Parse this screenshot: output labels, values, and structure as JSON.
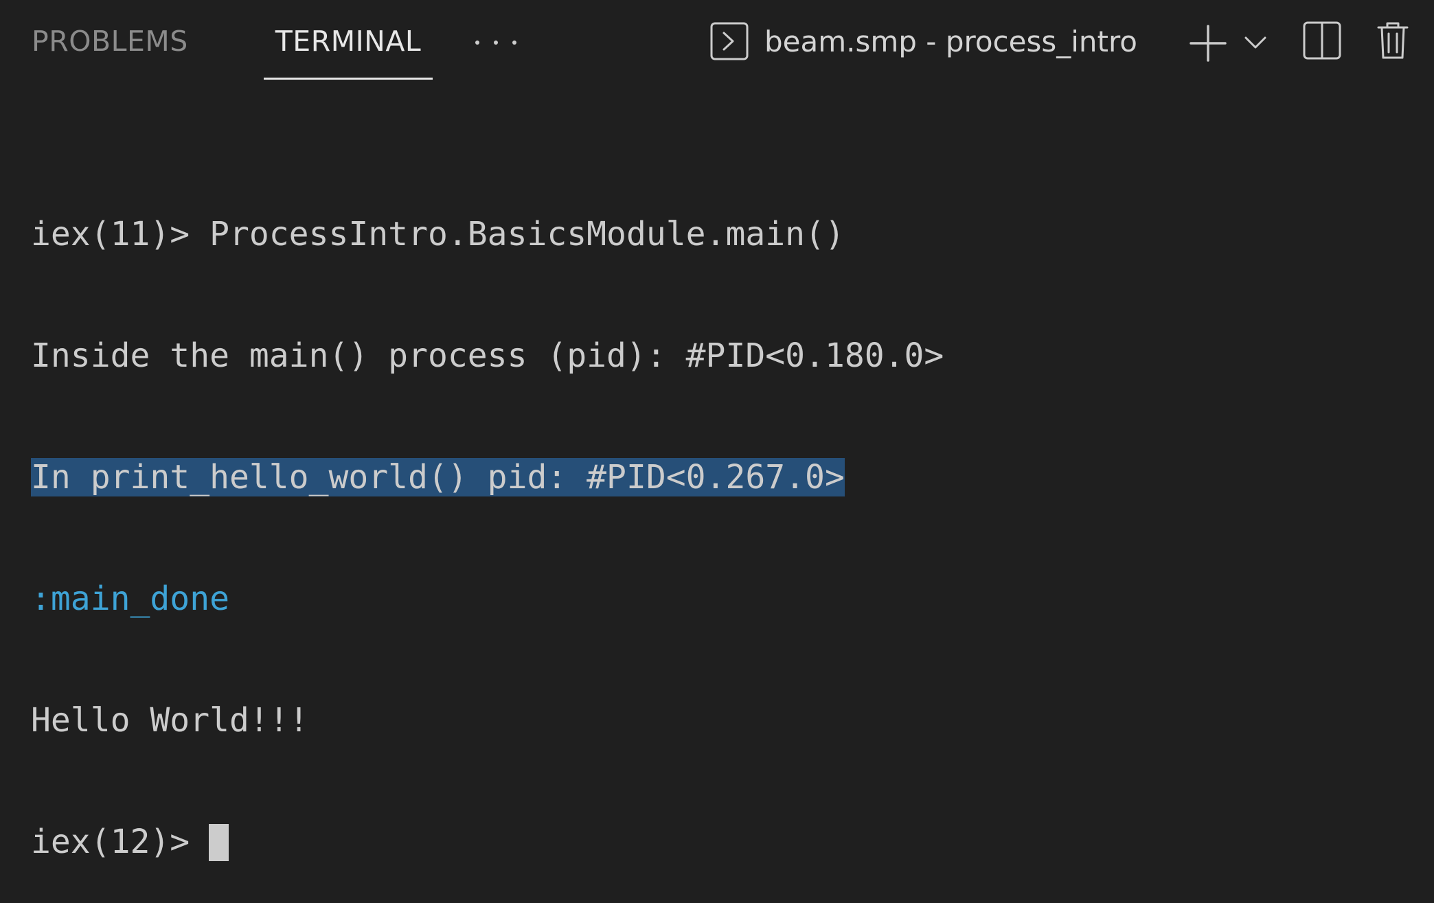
{
  "panel": {
    "tabs": [
      {
        "label": "PROBLEMS",
        "active": false
      },
      {
        "label": "TERMINAL",
        "active": true
      }
    ],
    "more_icon": "ellipsis-icon",
    "terminal_title": "beam.smp - process_intro",
    "icons": {
      "terminal": "terminal-icon",
      "new_terminal": "plus-icon",
      "dropdown": "chevron-down-icon",
      "split": "split-editor-icon",
      "kill": "trash-icon"
    }
  },
  "terminal": {
    "lines": [
      "iex(11)> ProcessIntro.BasicsModule.main()",
      "Inside the main() process (pid): #PID<0.180.0>",
      "In print_hello_world() pid: #PID<0.267.0>",
      ":main_done",
      "Hello World!!!"
    ],
    "prompt": "iex(12)>"
  },
  "colors": {
    "background": "#1f1f1f",
    "text": "#cccccc",
    "selection": "#264f78",
    "atom": "#3ea3d6",
    "inactive_tab": "#8b8b8b",
    "active_tab": "#e7e7e7"
  }
}
